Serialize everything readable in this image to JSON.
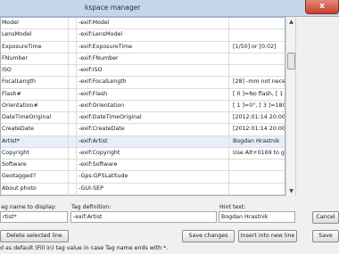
{
  "window": {
    "title": "kspace manager",
    "close_glyph": "x"
  },
  "grid": {
    "rows": [
      {
        "name": "Model",
        "def": "-exif:Model",
        "hint": ""
      },
      {
        "name": "LensModel",
        "def": "-exif:LensModel",
        "hint": ""
      },
      {
        "name": "ExposureTime",
        "def": "-exif:ExposureTime",
        "hint": "[1/50] or [0.02]"
      },
      {
        "name": "FNumber",
        "def": "-exif:FNumber",
        "hint": ""
      },
      {
        "name": "ISO",
        "def": "-exif:ISO",
        "hint": ""
      },
      {
        "name": "FocalLength",
        "def": "-exif:FocalLength",
        "hint": "[28] -mm not necessary"
      },
      {
        "name": "Flash#",
        "def": "-exif:Flash",
        "hint": "[ 0 ]=No flash, [ 1 ]=Flash fired"
      },
      {
        "name": "Orientation#",
        "def": "-exif:Orientation",
        "hint": "[ 1 ]=0°, [ 3 ]=180°, [ 6 ]=+90°, [ 8 ]=-90°"
      },
      {
        "name": "DateTimeOriginal",
        "def": "-exif:DateTimeOriginal",
        "hint": "[2012:01:14 20:00:00]"
      },
      {
        "name": "CreateDate",
        "def": "-exif:CreateDate",
        "hint": "[2012:01:14 20:00:00]"
      },
      {
        "name": "Artist*",
        "def": "-exif:Artist",
        "hint": "Bogdan Hrastnik"
      },
      {
        "name": "Copyright",
        "def": "-exif:Copyright",
        "hint": "Use Alt+0169 to get © character"
      },
      {
        "name": "Software",
        "def": "-exif:Software",
        "hint": ""
      },
      {
        "name": "Geotagged?",
        "def": "-Gps:GPSLatitude",
        "hint": ""
      },
      {
        "name": "About photo",
        "def": "-GUI-SEP",
        "hint": ""
      }
    ]
  },
  "scrollbar": {
    "up_glyph": "▲",
    "down_glyph": "▼"
  },
  "form": {
    "tag_name_label": "ag name to display:",
    "tag_name_value": "rtist*",
    "tag_def_label": "Tag definition:",
    "tag_def_value": "-exif:Artist",
    "hint_label": "Hint text:",
    "hint_value": "Bogdan Hrastnik"
  },
  "buttons": {
    "delete": "Delete selected line",
    "save_changes": "Save changes",
    "insert": "Insert into new line",
    "cancel": "Cancel",
    "save": "Save"
  },
  "status": "d as default (Fill in) tag value in case Tag name ends with *."
}
